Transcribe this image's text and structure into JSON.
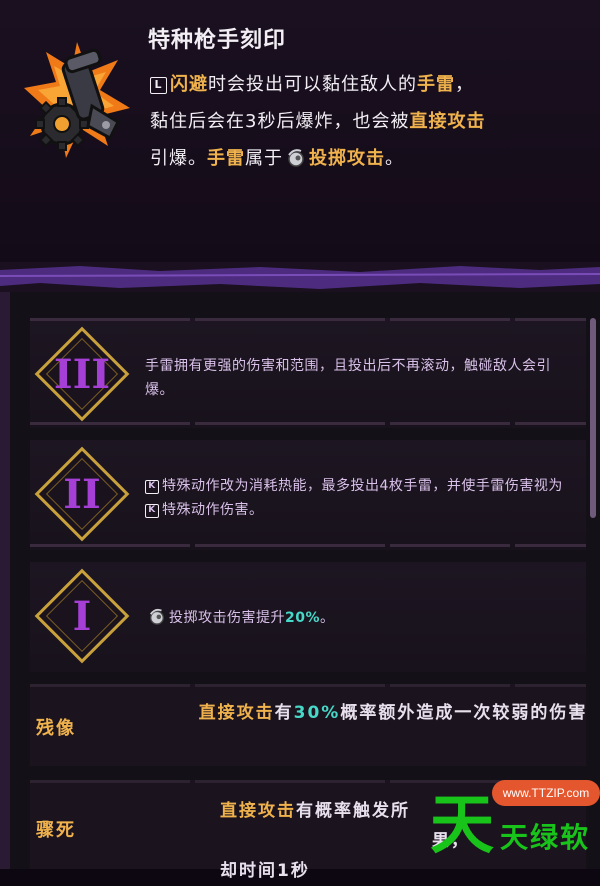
{
  "header": {
    "title": "特种枪手刻印",
    "emblem_icon": "grenade-launcher-emblem-icon",
    "desc": {
      "key_l": "L",
      "dodge": "闪避",
      "part1": "时会投出可以黏住敌人的",
      "grenade": "手雷",
      "part2": "，",
      "line2a": "黏住后会在3秒后爆炸，也会被",
      "direct": "直接攻击",
      "line3a": "引爆。",
      "grenade2": "手雷",
      "line3b": "属于",
      "throw": "投掷攻击",
      "line3c": "。"
    }
  },
  "upgrades": [
    {
      "rank": "III",
      "text": "手雷拥有更强的伤害和范围，且投出后不再滚动，触碰敌人会引爆。"
    },
    {
      "rank": "II",
      "key": "K",
      "text_a": "特殊动作改为消耗热能，最多投出4枚手雷，并使手雷伤害视为",
      "key2": "K",
      "text_b": "特殊动作伤害。"
    },
    {
      "rank": "I",
      "text_a": "投掷攻击伤害提升",
      "value": "20%",
      "text_b": "。"
    }
  ],
  "traits": [
    {
      "name": "残像",
      "desc_a": "直接攻击",
      "desc_b": "有",
      "value": "30%",
      "desc_c": "概率额外造成一次较弱的伤害"
    },
    {
      "name": "骤死",
      "desc_a": "直接攻击",
      "desc_b": "有概率触发所",
      "desc_c": "果，",
      "desc_d": "却时间1秒"
    }
  ],
  "watermark": {
    "site": "www.TTZIP.com",
    "big": "天",
    "small": "天绿软"
  },
  "colors": {
    "accent_gold": "#f0b24c",
    "accent_teal": "#47d8c8",
    "rank_purple": "#a63fd6",
    "diamond_gold": "#c9a13c",
    "divider_purple": "#4d2c80"
  }
}
